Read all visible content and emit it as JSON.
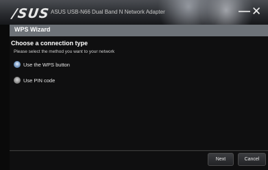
{
  "window": {
    "logo_text": "/SUS",
    "title": "ASUS USB-N66 Dual Band N Network Adapter",
    "minimize_glyph": "—",
    "close_glyph": "✕"
  },
  "section": {
    "title": "WPS Wizard"
  },
  "main": {
    "heading": "Choose a connection type",
    "description": "Please select the method you want to your network",
    "options": [
      {
        "label": "Use the WPS button",
        "selected": true
      },
      {
        "label": "Use PIN code",
        "selected": false
      }
    ]
  },
  "footer": {
    "next_label": "Next",
    "cancel_label": "Cancel"
  },
  "colors": {
    "section_bar": "#6d7278",
    "radio_selected": "#8aa9cf",
    "background": "#0f0f10"
  }
}
